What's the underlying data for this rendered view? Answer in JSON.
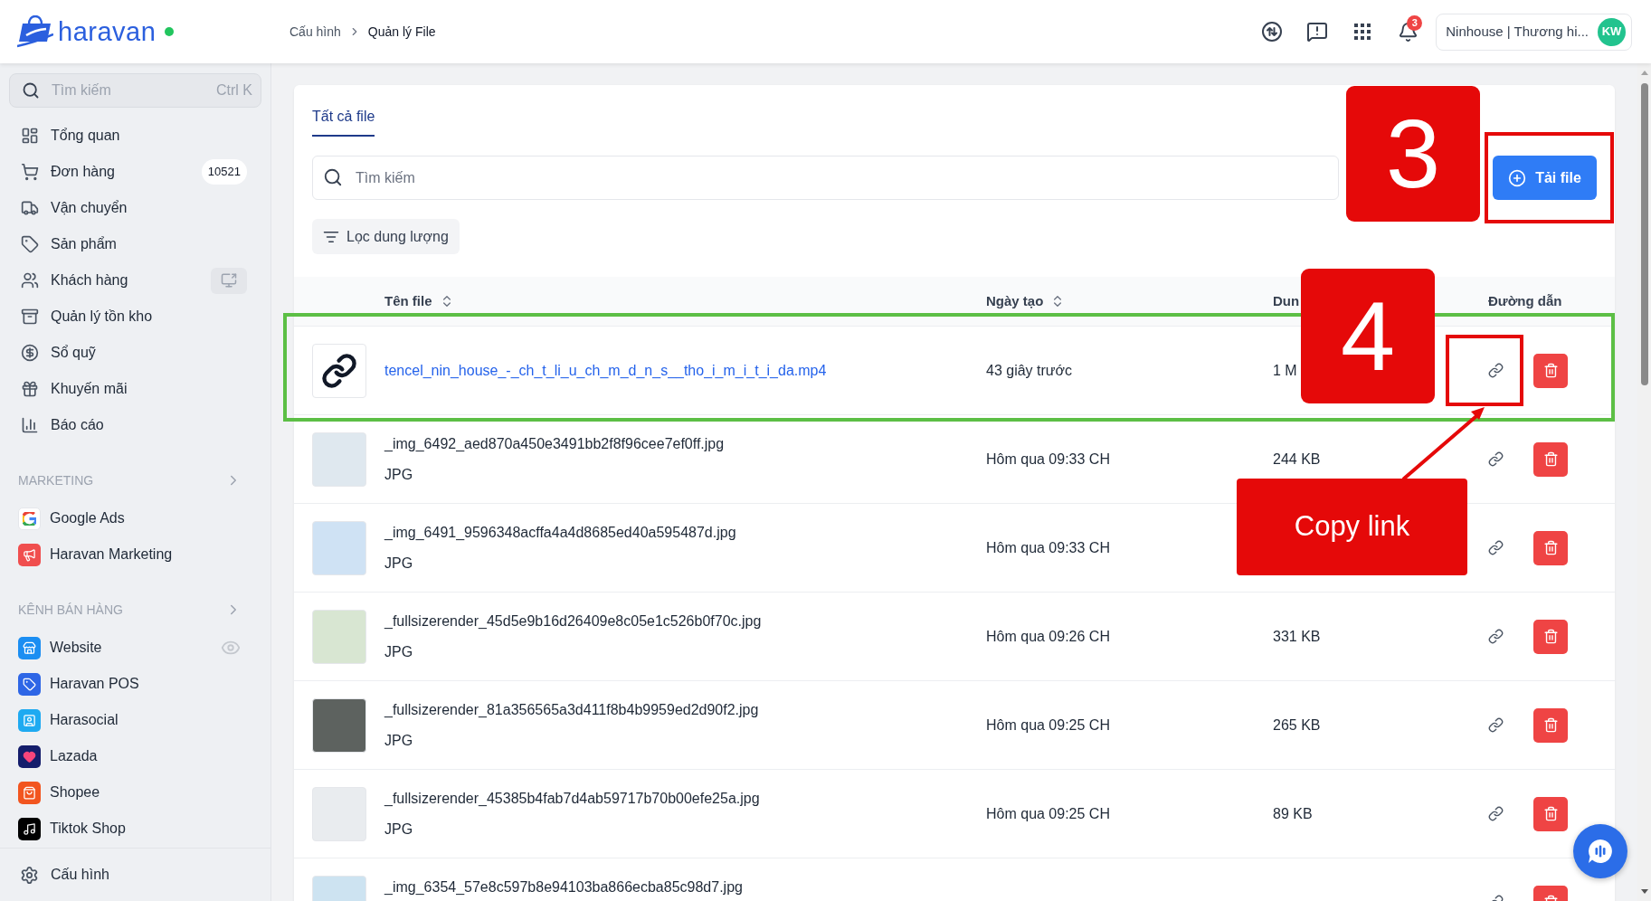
{
  "header": {
    "logo_text": "haravan",
    "online": true,
    "breadcrumb": [
      "Cấu hình",
      "Quản lý File"
    ],
    "notification_count": "3",
    "account": {
      "name": "Ninhouse | Thương hi...",
      "initials": "KW"
    }
  },
  "sidebar": {
    "search": {
      "placeholder": "Tìm kiếm",
      "shortcut": "Ctrl K"
    },
    "items": [
      {
        "label": "Tổng quan",
        "selected": false
      },
      {
        "label": "Đơn hàng",
        "badge": "10521",
        "selected": false
      },
      {
        "label": "Vận chuyển",
        "selected": false
      },
      {
        "label": "Sản phẩm",
        "selected": false
      },
      {
        "label": "Khách hàng",
        "selected": false
      },
      {
        "label": "Quản lý tồn kho",
        "selected": false
      },
      {
        "label": "Sổ quỹ",
        "selected": false
      },
      {
        "label": "Khuyến mãi",
        "selected": false
      },
      {
        "label": "Báo cáo",
        "selected": false
      }
    ],
    "sections": [
      {
        "title": "MARKETING",
        "items": [
          {
            "label": "Google Ads",
            "selected": false
          },
          {
            "label": "Haravan Marketing",
            "selected": false
          }
        ]
      },
      {
        "title": "KÊNH BÁN HÀNG",
        "items": [
          {
            "label": "Website",
            "selected": false
          },
          {
            "label": "Haravan POS",
            "selected": false
          },
          {
            "label": "Harasocial",
            "selected": false
          },
          {
            "label": "Lazada",
            "selected": false
          },
          {
            "label": "Shopee",
            "selected": false
          },
          {
            "label": "Tiktok Shop",
            "selected": false
          }
        ]
      }
    ],
    "footer": {
      "label": "Cấu hình",
      "selected": false
    }
  },
  "main": {
    "tabs": [
      {
        "label": "Tất cả file",
        "selected": true
      }
    ],
    "search": {
      "placeholder": "Tìm kiếm"
    },
    "upload_button": "Tải file",
    "filter_button": "Lọc dung lượng",
    "table": {
      "columns": [
        {
          "label": "Tên file",
          "sortable": true
        },
        {
          "label": "Ngày tạo",
          "sortable": true
        },
        {
          "label": "Dun",
          "sortable": false
        },
        {
          "label": "Đường dẫn",
          "sortable": false
        }
      ],
      "rows": [
        {
          "kind": "attachment",
          "name": "tencel_nin_house_-_ch_t_li_u_ch_m_d_n_s__tho_i_m_i_t_i_da.mp4",
          "created": "43 giây trước",
          "size": "1 M"
        },
        {
          "kind": "image",
          "name": "_img_6492_aed870a450e3491bb2f8f96cee7ef0ff.jpg",
          "type": "JPG",
          "created": "Hôm qua 09:33 CH",
          "size": "244 KB"
        },
        {
          "kind": "image",
          "name": "_img_6491_9596348acffa4a4d8685ed40a595487d.jpg",
          "type": "JPG",
          "created": "Hôm qua 09:33 CH"
        },
        {
          "kind": "image",
          "name": "_fullsizerender_45d5e9b16d26409e8c05e1c526b0f70c.jpg",
          "type": "JPG",
          "created": "Hôm qua 09:26 CH",
          "size": "331 KB"
        },
        {
          "kind": "image",
          "name": "_fullsizerender_81a356565a3d411f8b4b9959ed2d90f2.jpg",
          "type": "JPG",
          "created": "Hôm qua 09:25 CH",
          "size": "265 KB"
        },
        {
          "kind": "image",
          "name": "_fullsizerender_45385b4fab7d4ab59717b70b00efe25a.jpg",
          "type": "JPG",
          "created": "Hôm qua 09:25 CH",
          "size": "89 KB"
        },
        {
          "kind": "image",
          "name": "_img_6354_57e8c597b8e94103ba866ecba85c98d7.jpg"
        }
      ]
    }
  },
  "annotations": [
    {
      "kind": "badge",
      "text": "3"
    },
    {
      "kind": "frame",
      "color": "#e50909"
    },
    {
      "kind": "badge",
      "text": "4"
    },
    {
      "kind": "frame",
      "color": "#e50909"
    },
    {
      "kind": "callout",
      "text": "Copy link"
    },
    {
      "kind": "arrow"
    },
    {
      "kind": "frame",
      "color": "#5cbf45"
    }
  ]
}
